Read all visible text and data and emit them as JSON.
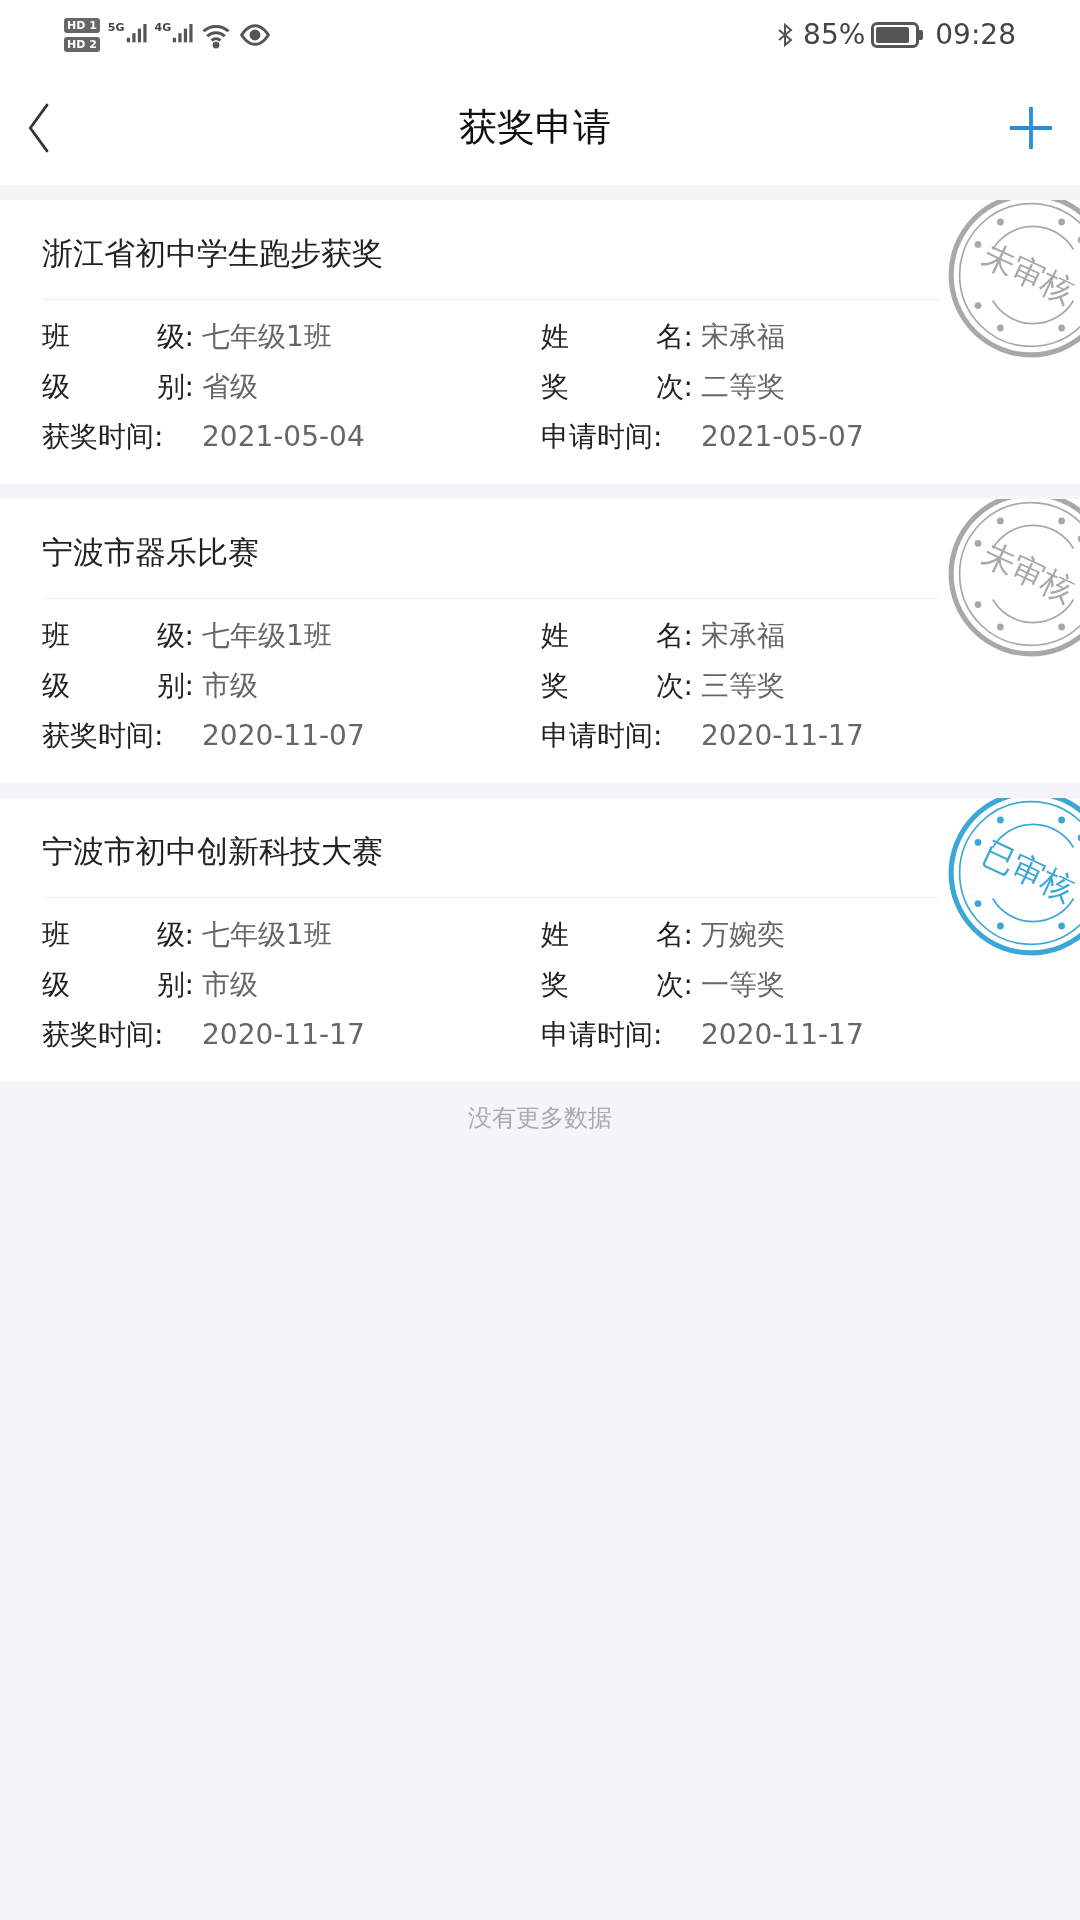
{
  "status_bar": {
    "sim_badges": [
      "HD 1",
      "HD 2"
    ],
    "networks": [
      "5G",
      "4G"
    ],
    "battery_text": "85%",
    "time": "09:28"
  },
  "header": {
    "title": "获奖申请"
  },
  "awards": [
    {
      "title": "浙江省初中学生跑步获奖",
      "stamp": {
        "text": "未审核",
        "kind": "pending"
      },
      "fields": [
        {
          "label": "班 级:",
          "value": "七年级1班"
        },
        {
          "label": "姓 名:",
          "value": "宋承福"
        },
        {
          "label": "级 别:",
          "value": "省级"
        },
        {
          "label": "奖 次:",
          "value": "二等奖"
        },
        {
          "label": "获奖时间:",
          "value": "2021-05-04"
        },
        {
          "label": "申请时间:",
          "value": "2021-05-07"
        }
      ]
    },
    {
      "title": "宁波市器乐比赛",
      "stamp": {
        "text": "未审核",
        "kind": "pending"
      },
      "fields": [
        {
          "label": "班 级:",
          "value": "七年级1班"
        },
        {
          "label": "姓 名:",
          "value": "宋承福"
        },
        {
          "label": "级 别:",
          "value": "市级"
        },
        {
          "label": "奖 次:",
          "value": "三等奖"
        },
        {
          "label": "获奖时间:",
          "value": "2020-11-07"
        },
        {
          "label": "申请时间:",
          "value": "2020-11-17"
        }
      ]
    },
    {
      "title": "宁波市初中创新科技大赛",
      "stamp": {
        "text": "已审核",
        "kind": "approved"
      },
      "fields": [
        {
          "label": "班 级:",
          "value": "七年级1班"
        },
        {
          "label": "姓 名:",
          "value": "万婉奕"
        },
        {
          "label": "级 别:",
          "value": "市级"
        },
        {
          "label": "奖 次:",
          "value": "一等奖"
        },
        {
          "label": "获奖时间:",
          "value": "2020-11-17"
        },
        {
          "label": "申请时间:",
          "value": "2020-11-17"
        }
      ]
    }
  ],
  "footer_text": "没有更多数据"
}
